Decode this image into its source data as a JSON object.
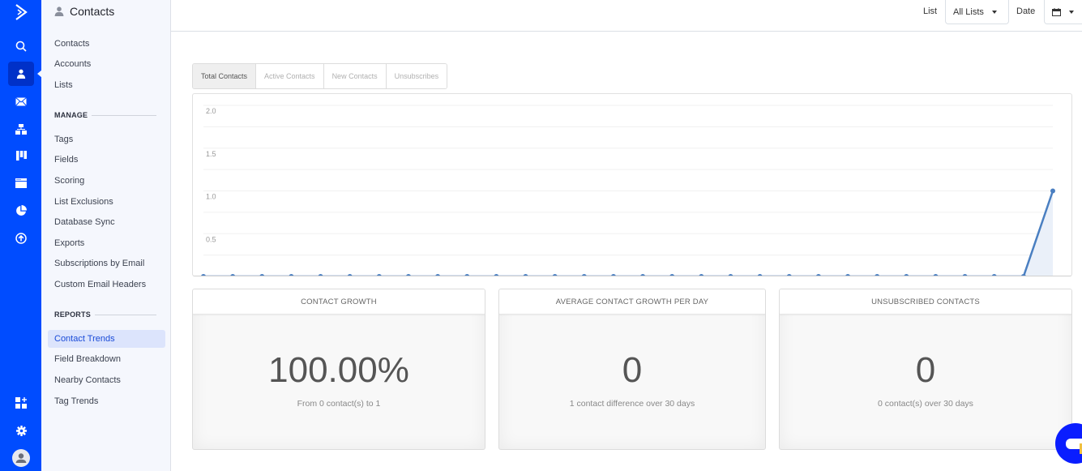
{
  "rail": {
    "icons": [
      "logo-icon",
      "search-icon",
      "contacts-icon",
      "email-icon",
      "automations-icon",
      "deals-icon",
      "website-icon",
      "reports-icon",
      "upgrade-icon",
      "apps-icon",
      "settings-icon",
      "user-avatar-icon"
    ],
    "active": "contacts-icon"
  },
  "sidebar": {
    "title": "Contacts",
    "items": [
      {
        "label": "Contacts"
      },
      {
        "label": "Accounts"
      },
      {
        "label": "Lists"
      }
    ],
    "manage": {
      "heading": "MANAGE",
      "items": [
        {
          "label": "Tags"
        },
        {
          "label": "Fields"
        },
        {
          "label": "Scoring"
        },
        {
          "label": "List Exclusions"
        },
        {
          "label": "Database Sync"
        },
        {
          "label": "Exports"
        },
        {
          "label": "Subscriptions by Email"
        },
        {
          "label": "Custom Email Headers"
        }
      ]
    },
    "reports": {
      "heading": "REPORTS",
      "items": [
        {
          "label": "Contact Trends",
          "active": true
        },
        {
          "label": "Field Breakdown"
        },
        {
          "label": "Nearby Contacts"
        },
        {
          "label": "Tag Trends"
        }
      ]
    }
  },
  "topbar": {
    "list_label": "List",
    "list_value": "All Lists",
    "date_label": "Date",
    "date_icon": "calendar-icon"
  },
  "tabs": [
    {
      "label": "Total Contacts",
      "active": true
    },
    {
      "label": "Active Contacts"
    },
    {
      "label": "New Contacts"
    },
    {
      "label": "Unsubscribes"
    }
  ],
  "chart_data": {
    "type": "area",
    "title": "",
    "xlabel": "",
    "ylabel": "",
    "ylim": [
      0,
      2.0
    ],
    "yticks": [
      0.5,
      1.0,
      1.5,
      2.0
    ],
    "ytick_labels": [
      "0.5",
      "1.0",
      "1.5",
      "2.0"
    ],
    "grid_step": 0.25,
    "grid": true,
    "series": [
      {
        "name": "Total Contacts",
        "color": "#4a7fc1",
        "values": [
          0,
          0,
          0,
          0,
          0,
          0,
          0,
          0,
          0,
          0,
          0,
          0,
          0,
          0,
          0,
          0,
          0,
          0,
          0,
          0,
          0,
          0,
          0,
          0,
          0,
          0,
          0,
          0,
          0,
          1
        ]
      }
    ]
  },
  "cards": [
    {
      "title": "CONTACT GROWTH",
      "value": "100.00%",
      "subtitle": "From 0 contact(s) to 1"
    },
    {
      "title": "AVERAGE CONTACT GROWTH PER DAY",
      "value": "0",
      "subtitle": "1 contact difference over 30 days"
    },
    {
      "title": "UNSUBSCRIBED CONTACTS",
      "value": "0",
      "subtitle": "0 contact(s) over 30 days"
    }
  ],
  "colors": {
    "rail": "#004cff",
    "accent": "#1a4bd8",
    "series": "#4a7fc1",
    "chat": "#0a1dff"
  }
}
